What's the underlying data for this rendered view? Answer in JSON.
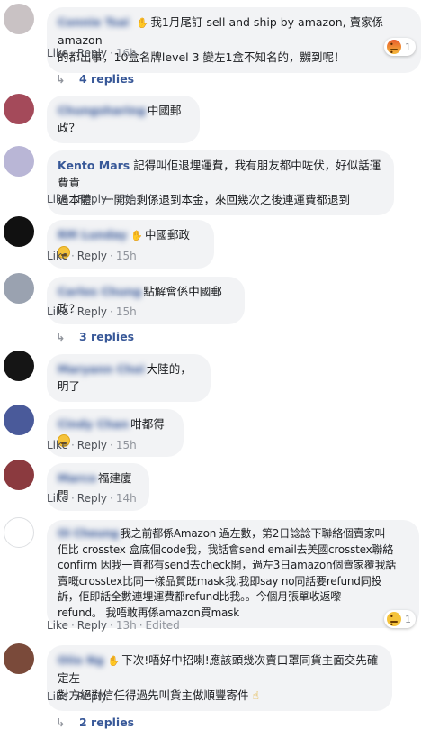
{
  "comments": [
    {
      "author": "Connie Tsai",
      "text": "我1月尾訂 sell and ship by amazon, 賣家係amazon的都出事，10盒名牌level 3 變左1盒不知名的，嬲到呢！",
      "line1": "我1月尾訂 sell and ship by amazon, 賣家係amazon",
      "line2": "的都出事，10盒名牌level 3 變左1盒不知名的，嬲到呢！",
      "like": "Like",
      "reply": "Reply",
      "time": "16h",
      "reaction": {
        "type": "angry",
        "count": "1"
      },
      "replies": "4 replies",
      "avatar_color": "#c9c2c4"
    },
    {
      "author": "Chungsharing",
      "text": "中國郵政？",
      "avatar_color": "#a44a5a"
    },
    {
      "author": "Kento Mars",
      "line1": "記得叫佢退埋運費，我有朋友都中咗伏，好似話運費貴",
      "line2": "過本體，一開始剩係退到本金，來回幾次之後連運費都退到",
      "like": "Like",
      "reply": "Reply",
      "time": "15h",
      "avatar_color": "#b9b6d6"
    },
    {
      "author": "RM Lunday",
      "text": "中國郵政",
      "like": "Like",
      "reply": "Reply",
      "time": "15h",
      "avatar_color": "#111111"
    },
    {
      "author": "Carlos Chung",
      "text": "點解會係中國郵政？",
      "like": "Like",
      "reply": "Reply",
      "time": "15h",
      "replies": "3 replies",
      "avatar_color": "#9aa2b0"
    },
    {
      "author": "Maryann Choi",
      "text": "大陸的，明了",
      "avatar_color": "#151515"
    },
    {
      "author": "Cindy Chan",
      "text": "咁都得",
      "like": "Like",
      "reply": "Reply",
      "time": "15h",
      "avatar_color": "#4a5a9a"
    },
    {
      "author": "Marco",
      "text": "福建廈門",
      "like": "Like",
      "reply": "Reply",
      "time": "14h",
      "avatar_color": "#8b3a3f"
    },
    {
      "author": "Oi Cheung",
      "lines": [
        "我之前都係Amazon 過左數，第2日諗諗下聯絡個賣家叫",
        "佢比 crosstex 盒底個code我，我話會send email去美國crosstex聯絡",
        "confirm 因我一直都有send去check開，過左3日amazon個賣家覆我話",
        "賣嘅crosstex比同一樣品質既mask我,我即say no同話要refund同投",
        "訴，佢即話全數連埋運費都refund比我。。今個月張單收返嚟",
        "refund。 我唔敢再係amazon買mask"
      ],
      "like": "Like",
      "reply": "Reply",
      "time": "13h",
      "edited": "Edited",
      "reaction": {
        "type": "sad",
        "count": "1"
      },
      "avatar_color": "#ffffff"
    },
    {
      "author": "Oiio Ng",
      "line1": "下次!唔好中招喇!應該頭幾次賣口罩同貨主面交先確定左",
      "line2": "對方絕對信任得過先叫貨主做順豐寄件",
      "like": "Like",
      "reply": "Reply",
      "time": "",
      "replies": "2 replies",
      "avatar_color": "#7a4a3a"
    }
  ],
  "action_separator": "·"
}
